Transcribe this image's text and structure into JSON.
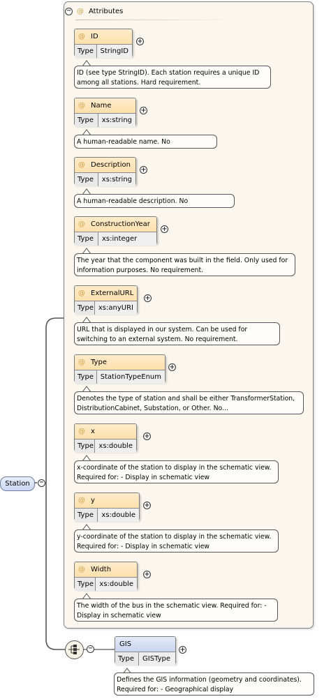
{
  "root": {
    "label": "Station",
    "toggle": "−"
  },
  "attributes_group": {
    "label": "Attributes",
    "toggle": "−",
    "at_symbol": "@"
  },
  "type_key": "Type",
  "attributes": [
    {
      "name": "ID",
      "type": "StringID",
      "description": "ID (see type StringID). Each station requires a unique ID among all stations. Hard requirement."
    },
    {
      "name": "Name",
      "type": "xs:string",
      "description": "A human-readable name. No requirement."
    },
    {
      "name": "Description",
      "type": "xs:string",
      "description": "A human-readable description. No requirement."
    },
    {
      "name": "ConstructionYear",
      "type": "xs:integer",
      "description": "The year that the component was built in the field. Only used for information purposes. No requirement."
    },
    {
      "name": "ExternalURL",
      "type": "xs:anyURI",
      "description": "URL that is displayed in our system. Can be used for switching to an external system. No requirement."
    },
    {
      "name": "Type",
      "type": "StationTypeEnum",
      "description": "Denotes the type of station and shall be either TransformerStation, DistributionCabinet, Substation, or Other. No..."
    },
    {
      "name": "x",
      "type": "xs:double",
      "description": "x-coordinate of the station to display in the schematic view. Required for: - Display in schematic view"
    },
    {
      "name": "y",
      "type": "xs:double",
      "description": "y-coordinate of the station to display in the schematic view. Required for: - Display in schematic view"
    },
    {
      "name": "Width",
      "type": "xs:double",
      "description": "The width of the bus in the schematic view. Required for: - Display in schematic view"
    }
  ],
  "sequence": {
    "toggle": "−"
  },
  "child_element": {
    "name": "GIS",
    "type": "GISType",
    "description": "Defines the GIS information (geometry and coordinates). Required for: - Geographical display"
  },
  "expand_symbol": "+",
  "colors": {
    "attribute_header": "#fde0ac",
    "element_header": "#c9d6ef",
    "panel_background": "#fbf7ef"
  },
  "icons": [
    "collapse-icon",
    "expand-icon",
    "sequence-compositor-icon",
    "attribute-icon"
  ]
}
